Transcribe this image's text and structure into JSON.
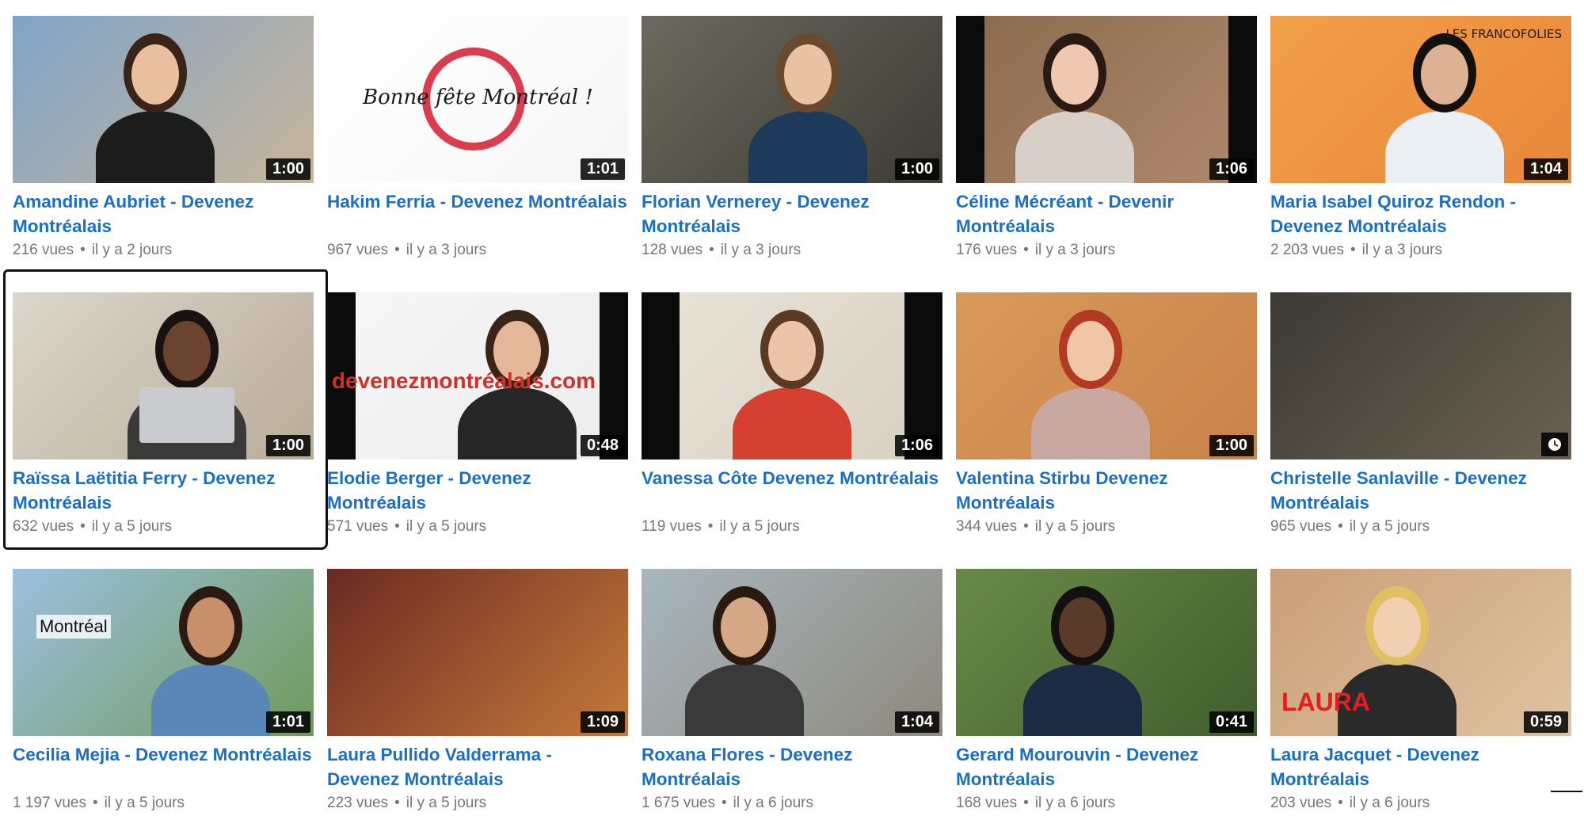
{
  "videos": [
    {
      "title": "Amandine Aubriet - Devenez Montréalais",
      "views": "216 vues",
      "age": "il y a 2 jours",
      "duration": "1:00",
      "bg": [
        "#7fa4c9",
        "#c9b59a"
      ]
    },
    {
      "title": "Hakim Ferria - Devenez Montréalais",
      "views": "967 vues",
      "age": "il y a 3 jours",
      "duration": "1:01",
      "bg": [
        "#ffffff",
        "#f6f6f6"
      ],
      "overlay": "Bonne fête Montréal !"
    },
    {
      "title": "Florian Vernerey - Devenez Montréalais",
      "views": "128 vues",
      "age": "il y a 3 jours",
      "duration": "1:00",
      "bg": [
        "#6b6a5e",
        "#3d3b33"
      ]
    },
    {
      "title": "Céline Mécréant - Devenir Montréalais",
      "views": "176 vues",
      "age": "il y a 3 jours",
      "duration": "1:06",
      "bg": [
        "#8a6a4e",
        "#b0896c"
      ]
    },
    {
      "title": "Maria Isabel Quiroz Rendon - Devenez Montréalais",
      "views": "2 203 vues",
      "age": "il y a 3 jours",
      "duration": "1:04",
      "bg": [
        "#f2a04a",
        "#e8873a"
      ],
      "overlay": "LES FRANCOFOLIES"
    },
    {
      "title": "Raïssa Laëtitia Ferry - Devenez Montréalais",
      "views": "632 vues",
      "age": "il y a 5 jours",
      "duration": "1:00",
      "bg": [
        "#dcd6cc",
        "#b9ab98"
      ]
    },
    {
      "title": "Elodie Berger - Devenez Montréalais",
      "views": "571 vues",
      "age": "il y a 5 jours",
      "duration": "0:48",
      "bg": [
        "#f7f7f7",
        "#ececec"
      ],
      "overlay": "devenezmontréalais.com"
    },
    {
      "title": "Vanessa Côte Devenez Montréalais",
      "views": "119 vues",
      "age": "il y a 5 jours",
      "duration": "1:06",
      "bg": [
        "#e9e3d8",
        "#d8cfc0"
      ]
    },
    {
      "title": "Valentina Stirbu Devenez Montréalais",
      "views": "344 vues",
      "age": "il y a 5 jours",
      "duration": "1:00",
      "bg": [
        "#d89a5a",
        "#c9824a"
      ]
    },
    {
      "title": "Christelle Sanlaville - Devenez Montréalais",
      "views": "965 vues",
      "age": "il y a 5 jours",
      "duration": "",
      "bg": [
        "#3c3a34",
        "#6b6152"
      ]
    },
    {
      "title": "Cecilia Mejia - Devenez Montréalais",
      "views": "1 197 vues",
      "age": "il y a 5 jours",
      "duration": "1:01",
      "bg": [
        "#9cc0e0",
        "#6f9a5a"
      ],
      "overlay": "Montréal"
    },
    {
      "title": "Laura Pullido Valderrama - Devenez Montréalais",
      "views": "223 vues",
      "age": "il y a 5 jours",
      "duration": "1:09",
      "bg": [
        "#6b2a22",
        "#c47a3a"
      ]
    },
    {
      "title": "Roxana Flores - Devenez Montréalais",
      "views": "1 675 vues",
      "age": "il y a 6 jours",
      "duration": "1:04",
      "bg": [
        "#a8b6c0",
        "#8e8a7c"
      ]
    },
    {
      "title": "Gerard Mourouvin - Devenez Montréalais",
      "views": "168 vues",
      "age": "il y a 6 jours",
      "duration": "0:41",
      "bg": [
        "#6a8a4a",
        "#3f5e2c"
      ]
    },
    {
      "title": "Laura Jacquet - Devenez Montréalais",
      "views": "203 vues",
      "age": "il y a 6 jours",
      "duration": "0:59",
      "bg": [
        "#c9a07a",
        "#e0c2a0"
      ],
      "overlay": "LAURA"
    }
  ],
  "highlighted_index": 5,
  "icons": {
    "watch_later": "clock-icon"
  },
  "colors": {
    "title": "#1a6fc4",
    "meta": "#767676",
    "duration_bg": "#000000"
  }
}
